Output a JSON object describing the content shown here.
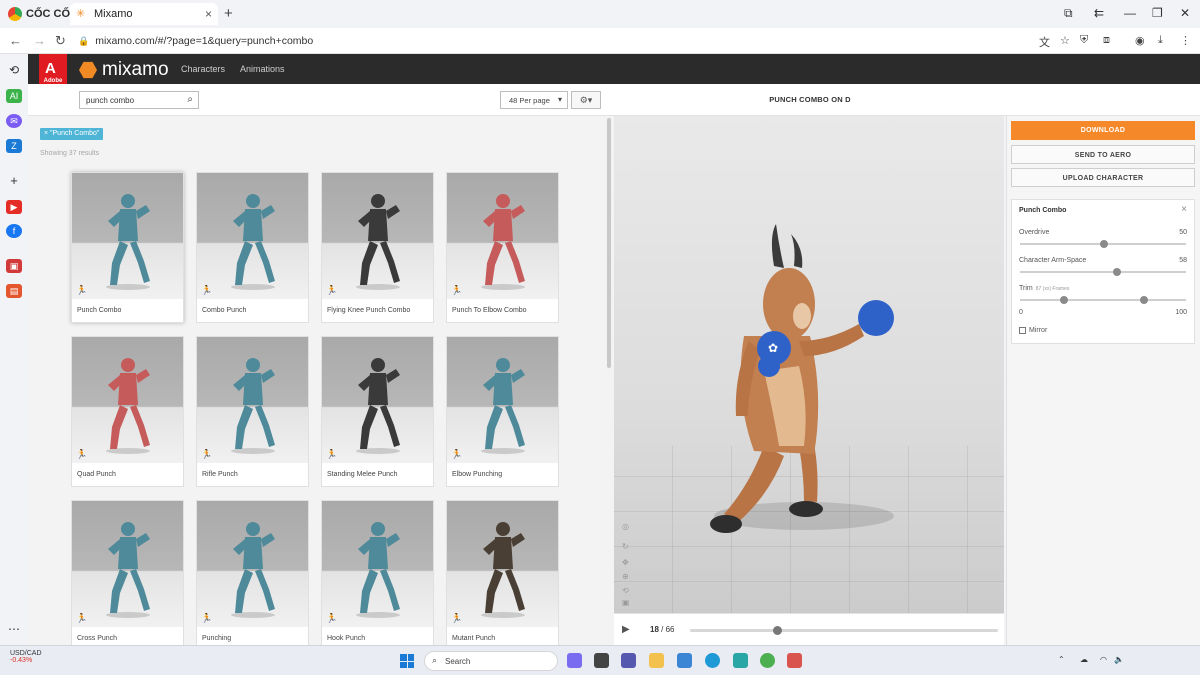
{
  "browser": {
    "name": "CỐC CỐC",
    "tab_title": "Mixamo",
    "url": "mixamo.com/#/?page=1&query=punch+combo"
  },
  "mixamo": {
    "brand": "mixamo",
    "adobe_label": "Adobe",
    "nav": [
      "Characters",
      "Animations"
    ]
  },
  "search": {
    "query": "punch combo",
    "per_page": "48 Per page"
  },
  "filter_tag": "× \"Punch Combo\"",
  "results_count": "Showing 37 results",
  "cards": [
    {
      "label": "Punch Combo",
      "color": "#4e8a99"
    },
    {
      "label": "Combo Punch",
      "color": "#4e8a99"
    },
    {
      "label": "Flying Knee Punch Combo",
      "color": "#3a3a3a"
    },
    {
      "label": "Punch To Elbow Combo",
      "color": "#c65b5b"
    },
    {
      "label": "Quad Punch",
      "color": "#c65b5b"
    },
    {
      "label": "Rifle Punch",
      "color": "#4e8a99"
    },
    {
      "label": "Standing Melee Punch",
      "color": "#3a3a3a"
    },
    {
      "label": "Elbow Punching",
      "color": "#4e8a99"
    },
    {
      "label": "Cross Punch",
      "color": "#4e8a99"
    },
    {
      "label": "Punching",
      "color": "#4e8a99"
    },
    {
      "label": "Hook Punch",
      "color": "#4e8a99"
    },
    {
      "label": "Mutant Punch",
      "color": "#4a3f35"
    }
  ],
  "viewer": {
    "title": "PUNCH COMBO ON D",
    "frame_current": "18",
    "frame_total": "/ 66"
  },
  "actions": {
    "download": "DOWNLOAD",
    "send_to_aero": "SEND TO AERO",
    "upload": "UPLOAD CHARACTER"
  },
  "properties": {
    "title": "Punch Combo",
    "overdrive_label": "Overdrive",
    "overdrive_value": "50",
    "arm_label": "Character Arm-Space",
    "arm_value": "58",
    "trim_label": "Trim",
    "trim_sub": "87 (xx) Frames",
    "trim_min": "0",
    "trim_max": "100",
    "mirror_label": "Mirror"
  },
  "taskbar": {
    "ticker_name": "USD/CAD",
    "ticker_change": "-0.43%",
    "search_label": "Search"
  }
}
